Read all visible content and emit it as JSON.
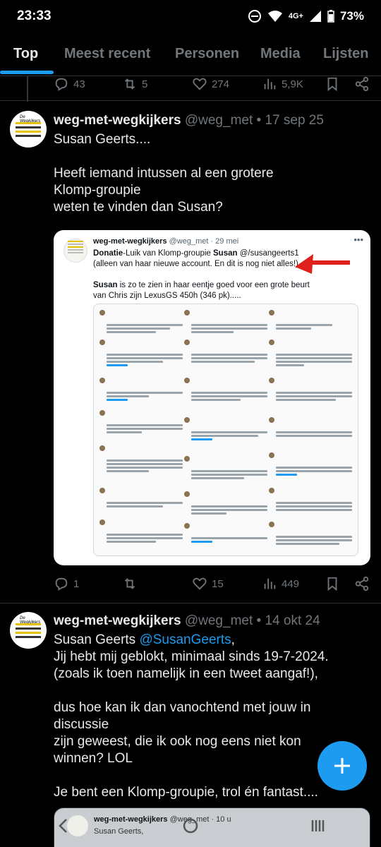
{
  "status_bar": {
    "time": "23:33",
    "network": "4G+",
    "battery": "73%"
  },
  "tabs": [
    {
      "label": "Top",
      "active": true
    },
    {
      "label": "Meest recent"
    },
    {
      "label": "Personen"
    },
    {
      "label": "Media"
    },
    {
      "label": "Lijsten"
    }
  ],
  "prev_tweet_actions": {
    "replies": "43",
    "reposts": "5",
    "likes": "274",
    "views": "5,9K"
  },
  "tweet1": {
    "name": "weg-met-wegkijkers",
    "handle": "@weg_met",
    "date": "• 17 sep 25",
    "text": "Susan Geerts....\n\nHeeft iemand intussen al een grotere\nKlomp-groupie\nweten te vinden dan Susan?",
    "embed": {
      "name": "weg-met-wegkijkers",
      "handle": "@weg_met · 29 mei",
      "text_line1_bold": "Donatie",
      "text_line1_rest": "-Luik van Klomp-groupie ",
      "text_line1_bold2": "Susan",
      "text_line1_end": " @/susangeerts1",
      "text_line2": "(alleen van haar nieuwe account. En dit is nog niet alles!)",
      "text_line3_bold": "Susan",
      "text_line3_rest": " is zo te zien in haar eentje goed voor een grote beurt",
      "text_line4": "van Chris zijn LexusGS 450h (346 pk)....."
    },
    "actions": {
      "replies": "1",
      "reposts": "",
      "likes": "15",
      "views": "449"
    }
  },
  "tweet2": {
    "name": "weg-met-wegkijkers",
    "handle": "@weg_met",
    "date": "• 14 okt 24",
    "text_start": "Susan Geerts ",
    "mention": "@SusanGeerts",
    "text_after_mention": ",",
    "text": "Jij hebt mij geblokt, minimaal sinds 19-7-2024.\n(zoals ik toen namelijk in een tweet aangaf!),\n\ndus hoe kan ik dan vanochtend met jouw in\ndiscussie\nzijn geweest, die ik ook nog eens niet kon\nwinnen? LOL\n\nJe bent een Klomp-groupie, trol én fantast....",
    "quote": {
      "name": "weg-met-wegkijkers",
      "handle": "@weg_met · 10 u",
      "text": "Susan Geerts,"
    }
  },
  "colors": {
    "accent": "#1d9bf0",
    "background": "#000000",
    "secondary_text": "#71767b"
  },
  "icons": [
    "reply-icon",
    "repost-icon",
    "like-icon",
    "views-icon",
    "bookmark-icon",
    "share-icon",
    "compose-icon"
  ]
}
